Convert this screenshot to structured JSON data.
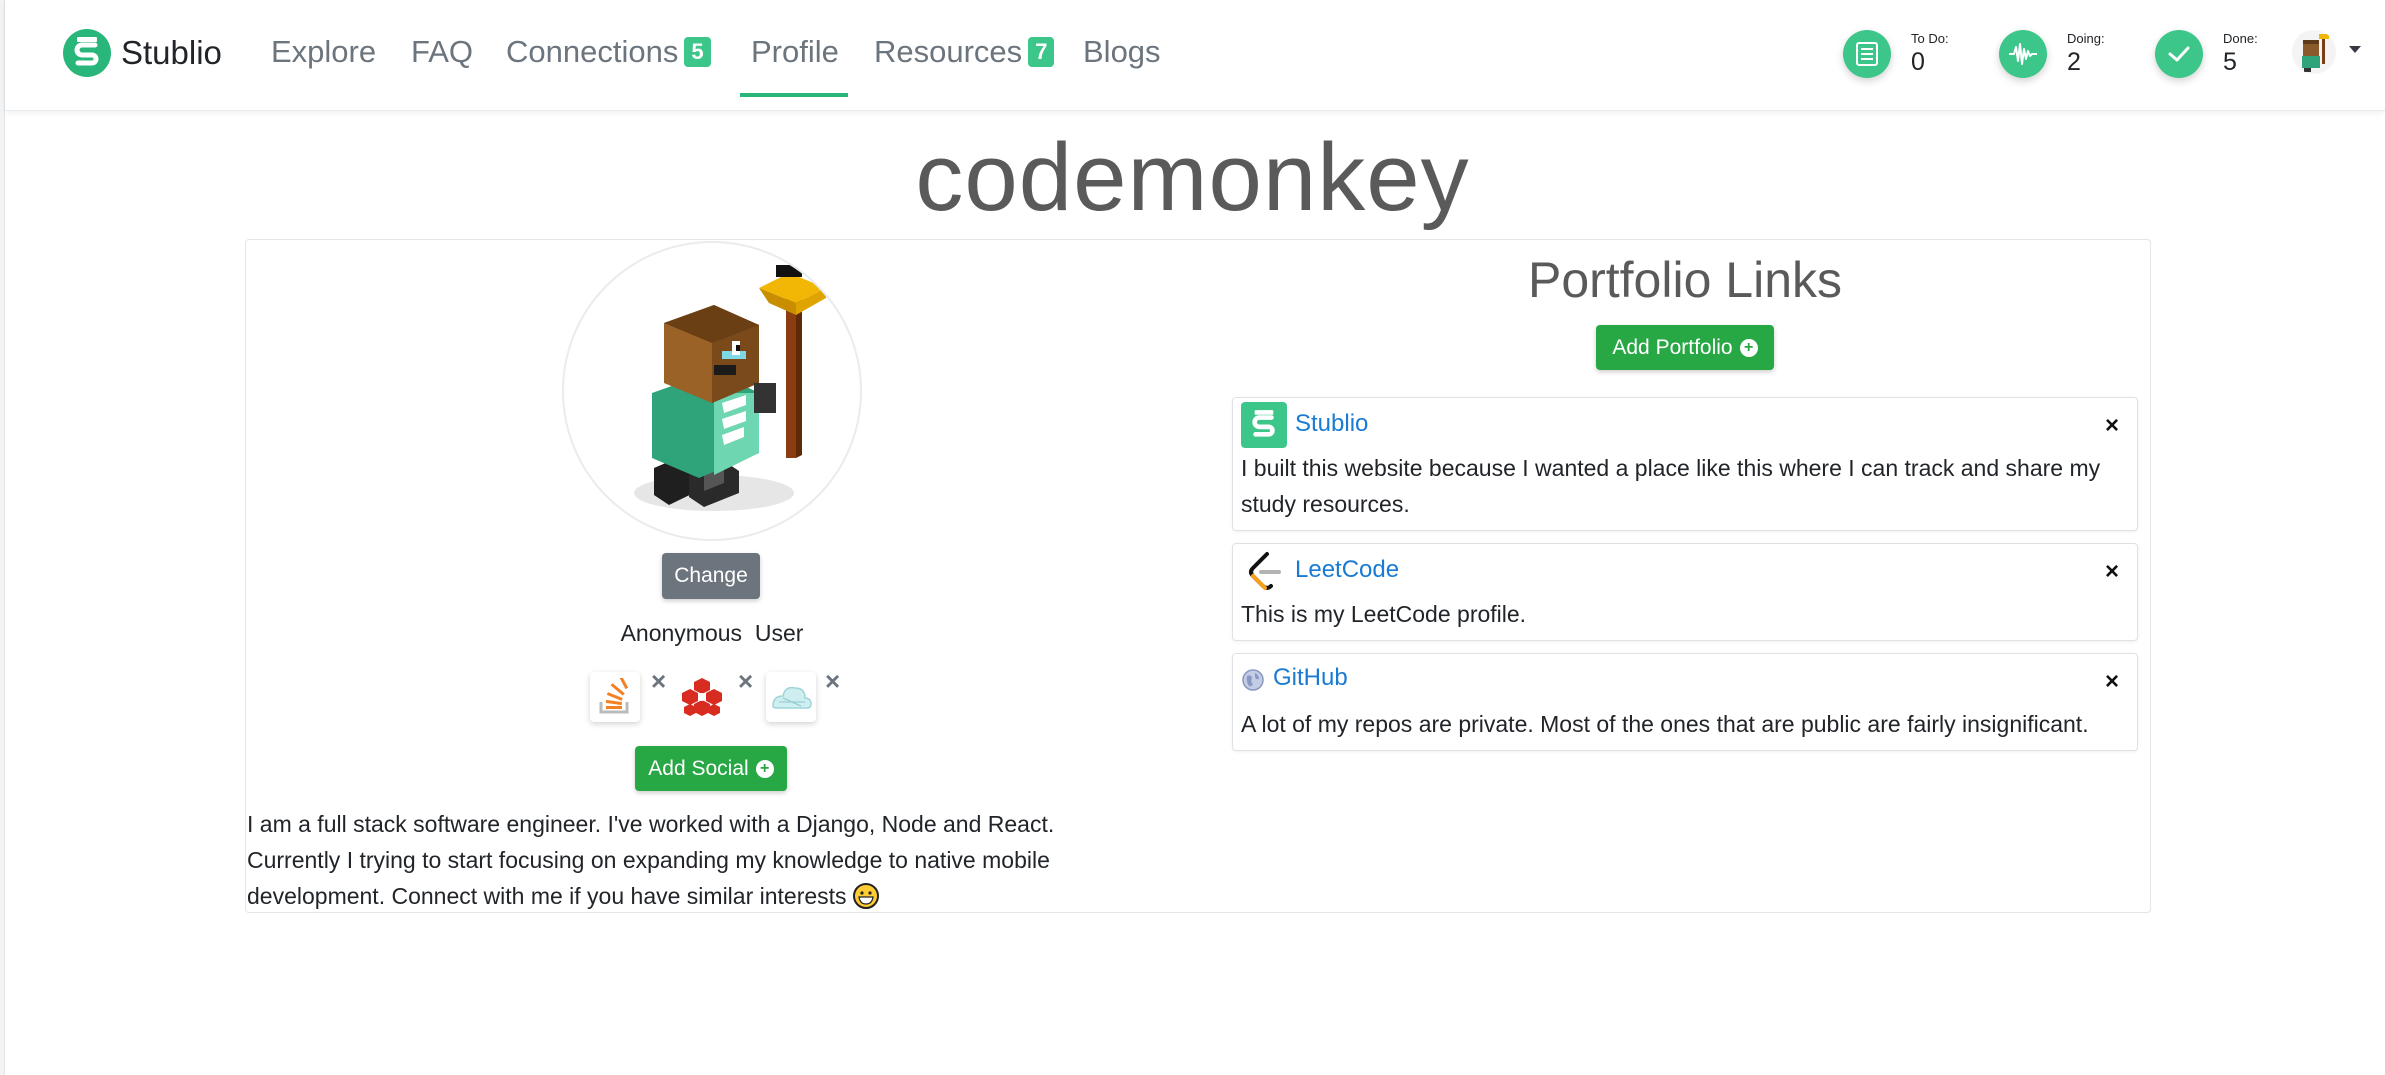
{
  "brand": {
    "name": "Stublio"
  },
  "nav": {
    "items": [
      {
        "label": "Explore"
      },
      {
        "label": "FAQ"
      },
      {
        "label": "Connections",
        "badge": "5"
      },
      {
        "label": "Profile",
        "active": true
      },
      {
        "label": "Resources",
        "badge": "7"
      },
      {
        "label": "Blogs"
      }
    ]
  },
  "stats": [
    {
      "label": "To Do:",
      "value": "0",
      "icon": "list-icon"
    },
    {
      "label": "Doing:",
      "value": "2",
      "icon": "waveform-icon"
    },
    {
      "label": "Done:",
      "value": "5",
      "icon": "check-icon"
    }
  ],
  "profile": {
    "username": "codemonkey",
    "change_label": "Change",
    "full_name": "Anonymous  User",
    "socials": [
      {
        "name": "stackoverflow-icon",
        "remove": "×"
      },
      {
        "name": "redis-icon",
        "remove": "×"
      },
      {
        "name": "cloud-icon",
        "remove": "×"
      }
    ],
    "add_social_label": "Add Social",
    "bio": "I am a full stack software engineer. I've worked with a Django, Node and React. Currently I trying to start focusing on expanding my knowledge to native mobile development. Connect with me if you have similar interests"
  },
  "portfolio": {
    "title": "Portfolio Links",
    "add_label": "Add Portfolio",
    "links": [
      {
        "title": "Stublio",
        "close": "×",
        "description": "I built this website because I wanted a place like this where I can track and share my study resources."
      },
      {
        "title": "LeetCode",
        "close": "×",
        "description": "This is my LeetCode profile."
      },
      {
        "title": "GitHub",
        "close": "×",
        "description": "A lot of my repos are private. Most of the ones that are public are fairly insignificant."
      }
    ]
  },
  "colors": {
    "accent": "#28b67a",
    "success_button": "#28a745",
    "link": "#1a7bd3"
  }
}
